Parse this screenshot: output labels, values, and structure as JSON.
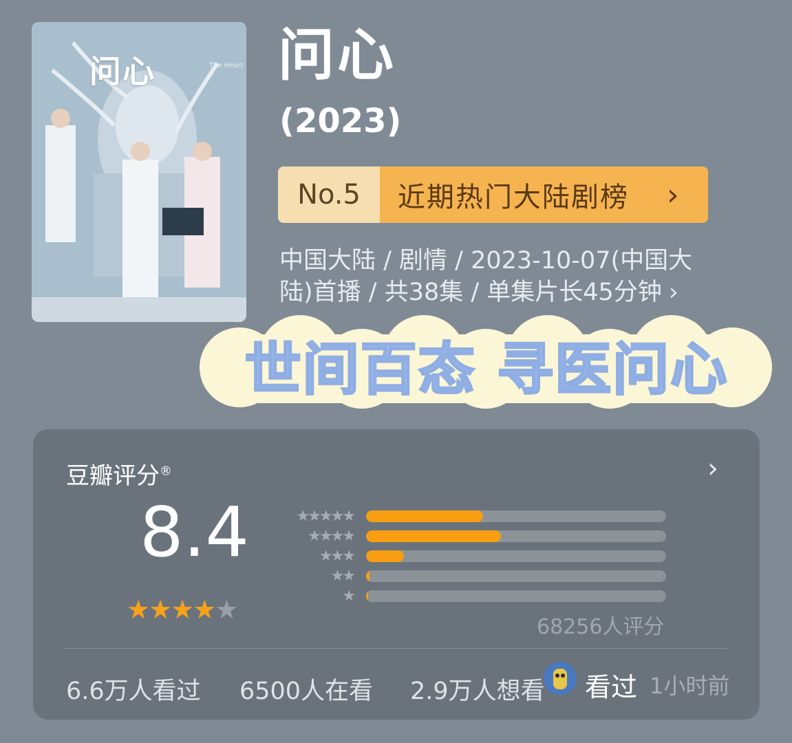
{
  "poster": {
    "title": "问心",
    "subtitle": "The Heart",
    "icon": "poster-image"
  },
  "show": {
    "title": "问心",
    "year": "(2023)"
  },
  "ranking": {
    "number": "No.5",
    "label": "近期热门大陆剧榜",
    "chevron": "›"
  },
  "meta": {
    "line1": "中国大陆 / 剧情 / 2023-10-07(中国大",
    "line2": "陆)首播 / 共38集 / 单集片长45分钟",
    "chevron": "›"
  },
  "slogan": "世间百态 寻医问心",
  "rating": {
    "title": "豆瓣评分",
    "registered": "®",
    "chevron": "›",
    "score": "8.4",
    "stars": {
      "filled": 4,
      "total": 5
    },
    "distribution": [
      {
        "stars": "★★★★★",
        "fraction": 0.39
      },
      {
        "stars": "★★★★",
        "fraction": 0.45
      },
      {
        "stars": "★★★",
        "fraction": 0.125
      },
      {
        "stars": "★★",
        "fraction": 0.012
      },
      {
        "stars": "★",
        "fraction": 0.006
      }
    ],
    "raters": "68256人评分"
  },
  "stats": {
    "watched": "6.6万人看过",
    "watching": "6500人在看",
    "want": "2.9万人想看"
  },
  "user": {
    "status": "看过",
    "time": "1小时前"
  },
  "colors": {
    "background": "#7f8a95",
    "accent": "#f89e13",
    "rank_left": "#f7deb0",
    "rank_right": "#f6b451",
    "card": "#6a737c"
  }
}
